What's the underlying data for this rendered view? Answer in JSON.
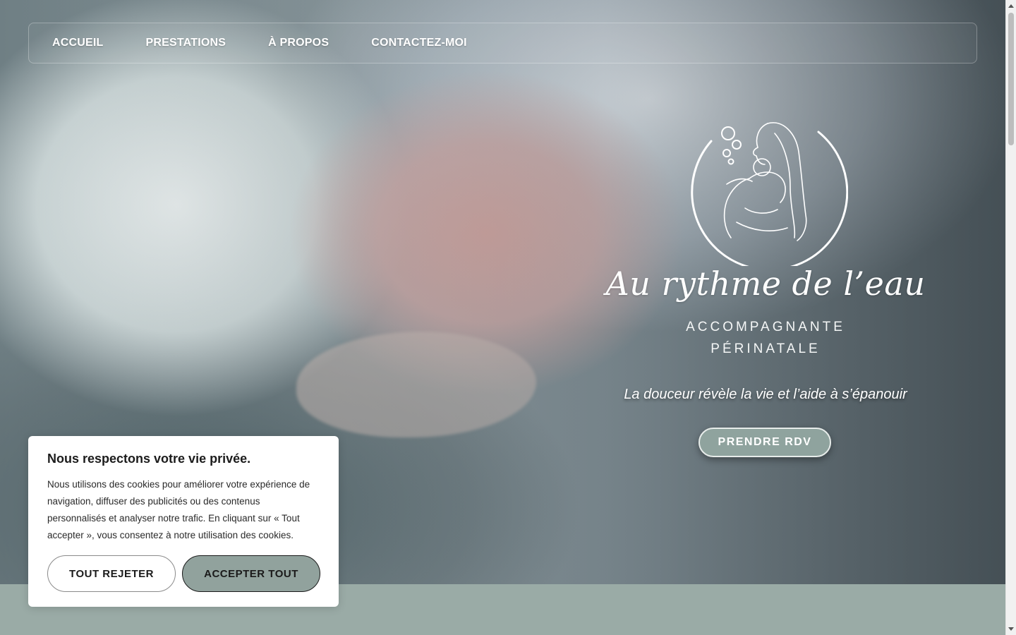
{
  "nav": {
    "items": [
      {
        "label": "ACCUEIL"
      },
      {
        "label": "PRESTATIONS"
      },
      {
        "label": "À PROPOS"
      },
      {
        "label": "CONTACTEZ-MOI"
      }
    ]
  },
  "hero": {
    "brand_name": "Au rythme de l’eau",
    "brand_sub_line1": "ACCOMPAGNANTE",
    "brand_sub_line2": "PÉRINATALE",
    "tagline": "La douceur révèle la vie et l’aide à s’épanouir",
    "cta_label": "PRENDRE RDV"
  },
  "cookie": {
    "title": "Nous respectons votre vie privée.",
    "text": "Nous utilisons des cookies pour améliorer votre expérience de navigation, diffuser des publicités ou des contenus personnalisés et analyser notre trafic. En cliquant sur « Tout accepter », vous consentez à notre utilisation des cookies.",
    "reject_label": "TOUT REJETER",
    "accept_label": "ACCEPTER TOUT"
  },
  "colors": {
    "accent": "#91a29d",
    "footer_band": "#9aaba6"
  },
  "icons": {
    "logo": "mother-and-baby-line-art-logo"
  }
}
